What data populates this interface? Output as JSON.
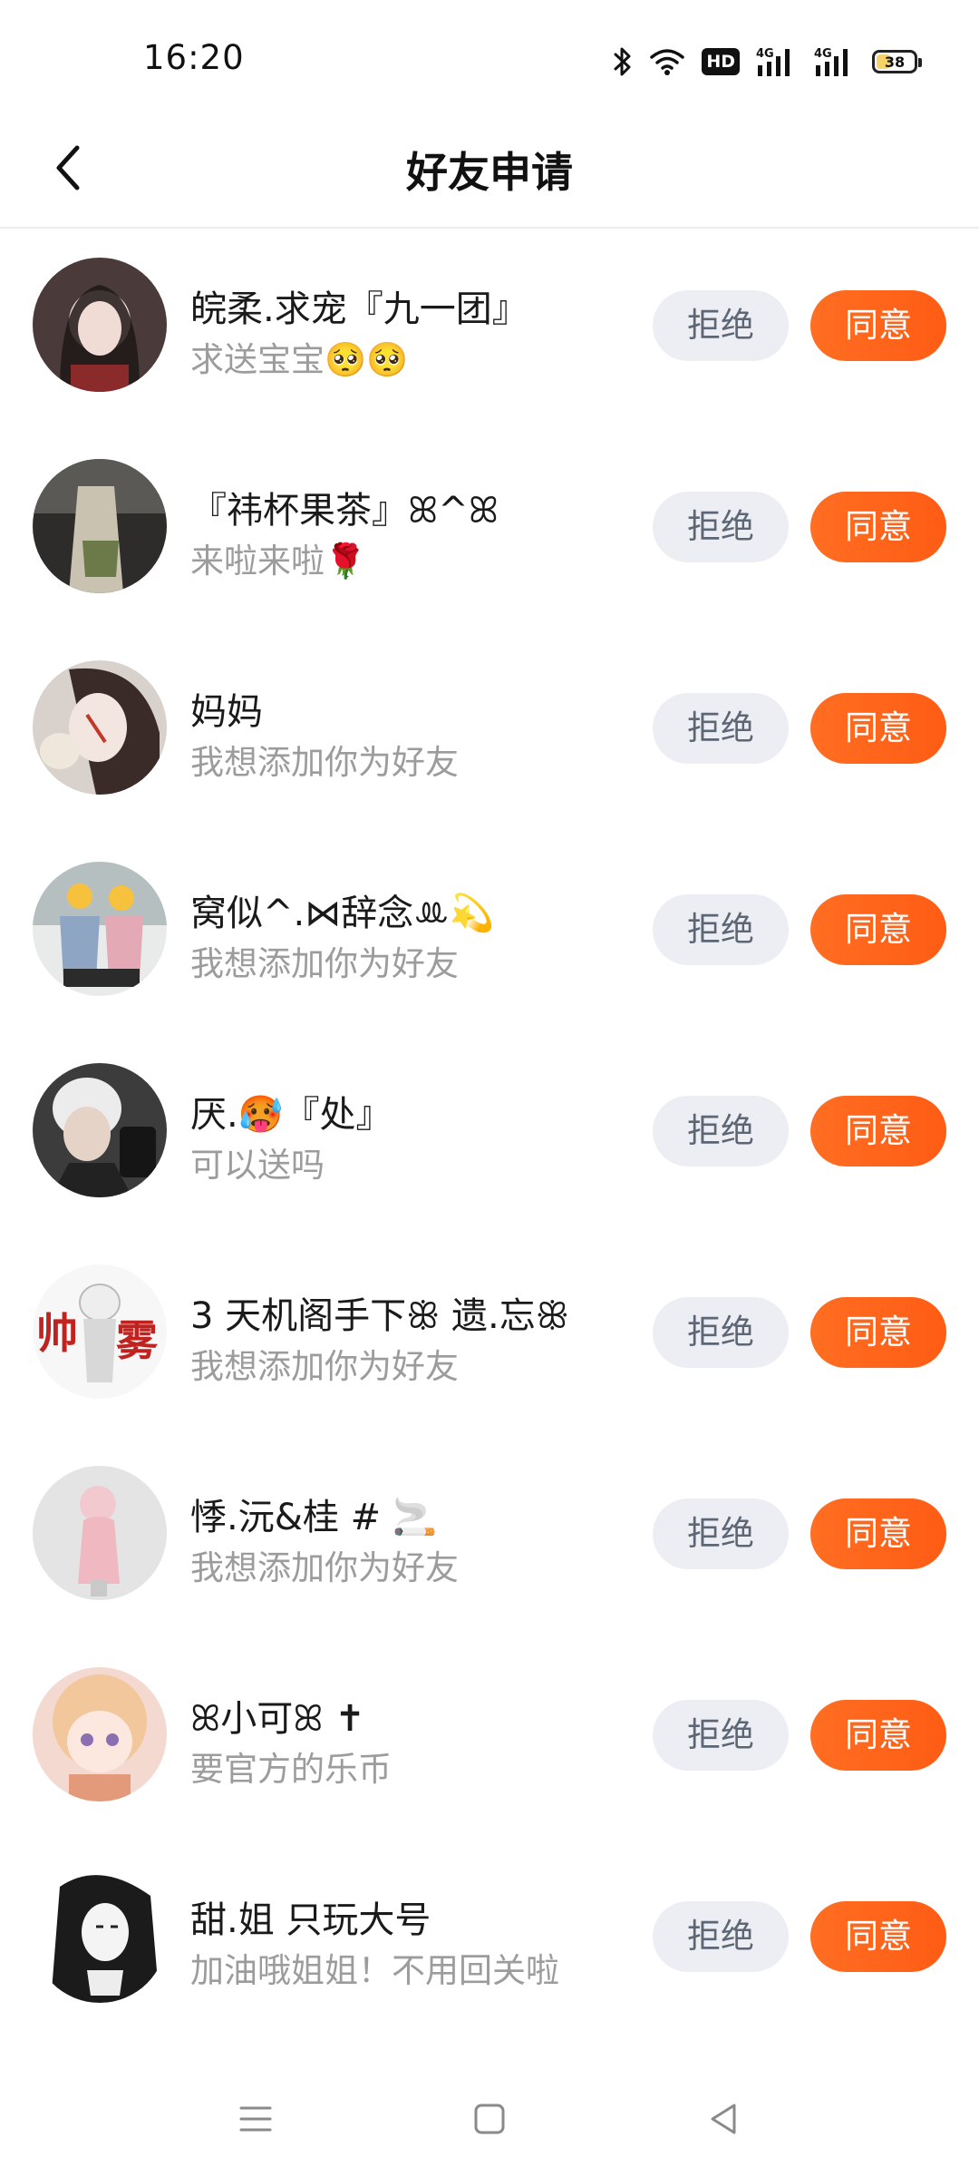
{
  "status_bar": {
    "time": "16:20",
    "network_1": "4G",
    "network_2": "4G",
    "hd_label": "HD",
    "battery_level": "38",
    "battery_fraction": 0.38,
    "icons": [
      "bluetooth-icon",
      "wifi-icon",
      "hd-icon",
      "signal-icon",
      "signal-icon",
      "battery-icon"
    ]
  },
  "header": {
    "title": "好友申请",
    "back_icon": "chevron-left-icon"
  },
  "buttons": {
    "reject_label": "拒绝",
    "accept_label": "同意"
  },
  "colors": {
    "accent": "#ff6219",
    "reject_bg": "#eceef3",
    "reject_text": "#5d6675",
    "secondary_text": "#9c9c9c"
  },
  "requests": [
    {
      "name": "皖柔.求宠『九一团』",
      "message": "求送宝宝🥺🥺"
    },
    {
      "name": "『祎杯果茶』ꕤ^ꕤ",
      "message": "来啦来啦🌹"
    },
    {
      "name": "妈妈",
      "message": "我想添加你为好友"
    },
    {
      "name": "窝似^.⋈辞念ꔛ💫",
      "message": "我想添加你为好友"
    },
    {
      "name": "厌.🥵『处』",
      "message": "可以送吗"
    },
    {
      "name": "3 天机阁手下ꕥ 遗.忘ꕥ",
      "message": "我想添加你为好友"
    },
    {
      "name": "悸.沅&桂 # 🚬",
      "message": "我想添加你为好友"
    },
    {
      "name": "ꕤ小可ꕤ ✝",
      "message": "要官方的乐币"
    },
    {
      "name": "甜.姐 只玩大号",
      "message": "加油哦姐姐！不用回关啦"
    }
  ],
  "nav_bar": {
    "icons": [
      "menu-icon",
      "home-square-icon",
      "back-triangle-icon"
    ]
  }
}
